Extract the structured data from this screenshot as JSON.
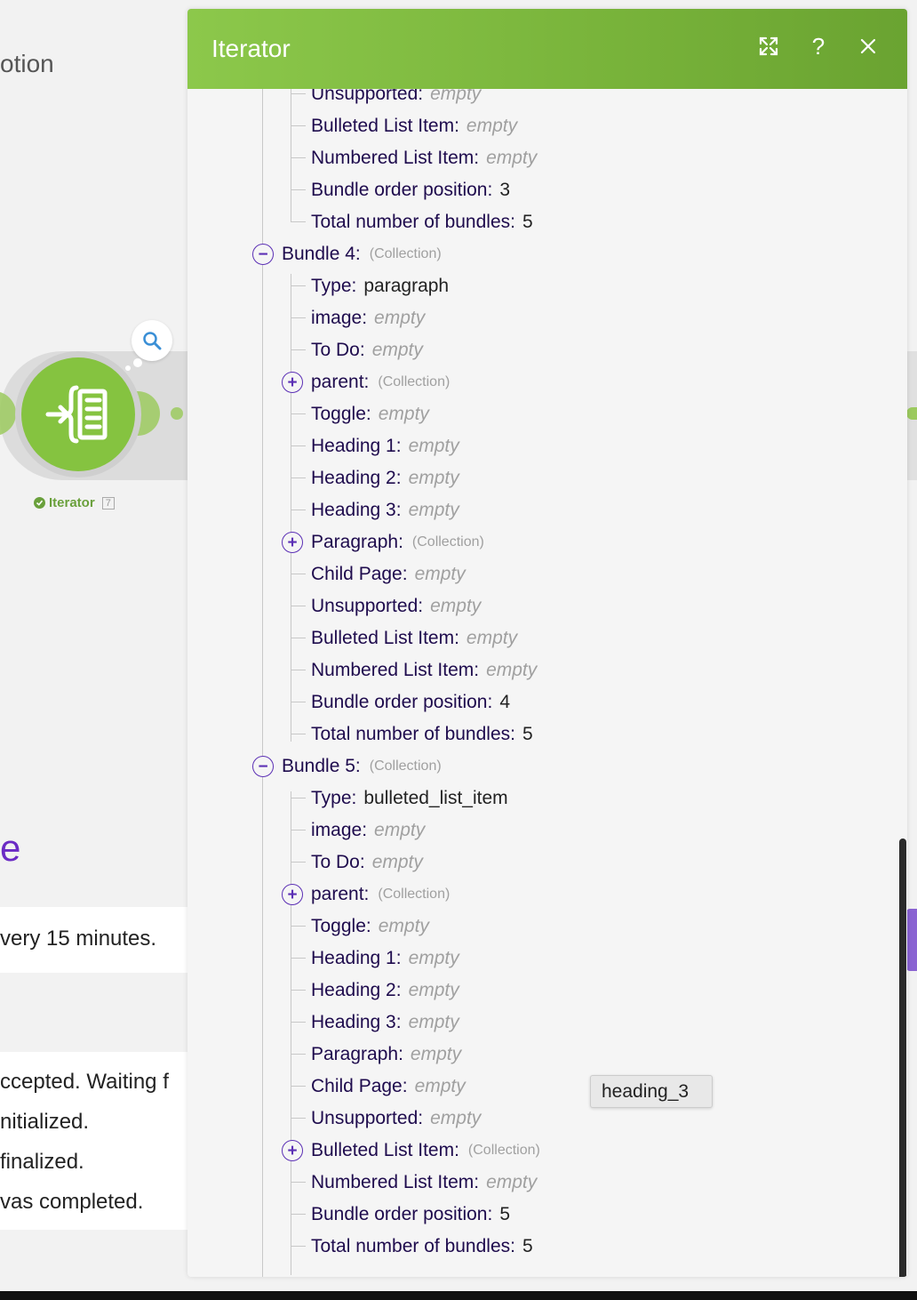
{
  "background": {
    "title_fragment": "otion",
    "module_label": "Iterator",
    "module_count": "7",
    "heading_fragment": "e",
    "schedule_text": "very 15 minutes.",
    "log_lines": [
      "ccepted. Waiting f",
      "nitialized.",
      "finalized.",
      "vas completed."
    ]
  },
  "dialog": {
    "title": "Iterator",
    "tooltip": "heading_3"
  },
  "tree": [
    {
      "depth": 1,
      "key": "Unsupported:",
      "value": "empty",
      "kind": "empty"
    },
    {
      "depth": 1,
      "key": "Bulleted List Item:",
      "value": "empty",
      "kind": "empty"
    },
    {
      "depth": 1,
      "key": "Numbered List Item:",
      "value": "empty",
      "kind": "empty"
    },
    {
      "depth": 1,
      "key": "Bundle order position:",
      "value": "3",
      "kind": "value"
    },
    {
      "depth": 1,
      "key": "Total number of bundles:",
      "value": "5",
      "kind": "value"
    },
    {
      "depth": 0,
      "key": "Bundle 4:",
      "value": "(Collection)",
      "kind": "collection",
      "toggle": "minus"
    },
    {
      "depth": 1,
      "key": "Type:",
      "value": "paragraph",
      "kind": "value"
    },
    {
      "depth": 1,
      "key": "image:",
      "value": "empty",
      "kind": "empty"
    },
    {
      "depth": 1,
      "key": "To Do:",
      "value": "empty",
      "kind": "empty"
    },
    {
      "depth": 1,
      "key": "parent:",
      "value": "(Collection)",
      "kind": "collection",
      "toggle": "plus"
    },
    {
      "depth": 1,
      "key": "Toggle:",
      "value": "empty",
      "kind": "empty"
    },
    {
      "depth": 1,
      "key": "Heading 1:",
      "value": "empty",
      "kind": "empty"
    },
    {
      "depth": 1,
      "key": "Heading 2:",
      "value": "empty",
      "kind": "empty"
    },
    {
      "depth": 1,
      "key": "Heading 3:",
      "value": "empty",
      "kind": "empty"
    },
    {
      "depth": 1,
      "key": "Paragraph:",
      "value": "(Collection)",
      "kind": "collection",
      "toggle": "plus"
    },
    {
      "depth": 1,
      "key": "Child Page:",
      "value": "empty",
      "kind": "empty"
    },
    {
      "depth": 1,
      "key": "Unsupported:",
      "value": "empty",
      "kind": "empty"
    },
    {
      "depth": 1,
      "key": "Bulleted List Item:",
      "value": "empty",
      "kind": "empty"
    },
    {
      "depth": 1,
      "key": "Numbered List Item:",
      "value": "empty",
      "kind": "empty"
    },
    {
      "depth": 1,
      "key": "Bundle order position:",
      "value": "4",
      "kind": "value"
    },
    {
      "depth": 1,
      "key": "Total number of bundles:",
      "value": "5",
      "kind": "value"
    },
    {
      "depth": 0,
      "key": "Bundle 5:",
      "value": "(Collection)",
      "kind": "collection",
      "toggle": "minus"
    },
    {
      "depth": 1,
      "key": "Type:",
      "value": "bulleted_list_item",
      "kind": "value"
    },
    {
      "depth": 1,
      "key": "image:",
      "value": "empty",
      "kind": "empty"
    },
    {
      "depth": 1,
      "key": "To Do:",
      "value": "empty",
      "kind": "empty"
    },
    {
      "depth": 1,
      "key": "parent:",
      "value": "(Collection)",
      "kind": "collection",
      "toggle": "plus"
    },
    {
      "depth": 1,
      "key": "Toggle:",
      "value": "empty",
      "kind": "empty"
    },
    {
      "depth": 1,
      "key": "Heading 1:",
      "value": "empty",
      "kind": "empty"
    },
    {
      "depth": 1,
      "key": "Heading 2:",
      "value": "empty",
      "kind": "empty"
    },
    {
      "depth": 1,
      "key": "Heading 3:",
      "value": "empty",
      "kind": "empty"
    },
    {
      "depth": 1,
      "key": "Paragraph:",
      "value": "empty",
      "kind": "empty"
    },
    {
      "depth": 1,
      "key": "Child Page:",
      "value": "empty",
      "kind": "empty"
    },
    {
      "depth": 1,
      "key": "Unsupported:",
      "value": "empty",
      "kind": "empty"
    },
    {
      "depth": 1,
      "key": "Bulleted List Item:",
      "value": "(Collection)",
      "kind": "collection",
      "toggle": "plus"
    },
    {
      "depth": 1,
      "key": "Numbered List Item:",
      "value": "empty",
      "kind": "empty"
    },
    {
      "depth": 1,
      "key": "Bundle order position:",
      "value": "5",
      "kind": "value"
    },
    {
      "depth": 1,
      "key": "Total number of bundles:",
      "value": "5",
      "kind": "value"
    }
  ],
  "colors": {
    "header_green": "#8cc84b",
    "key_text": "#1e0b4d",
    "toggle_purple": "#5b2fb5",
    "empty_text": "#a0a0a0"
  }
}
